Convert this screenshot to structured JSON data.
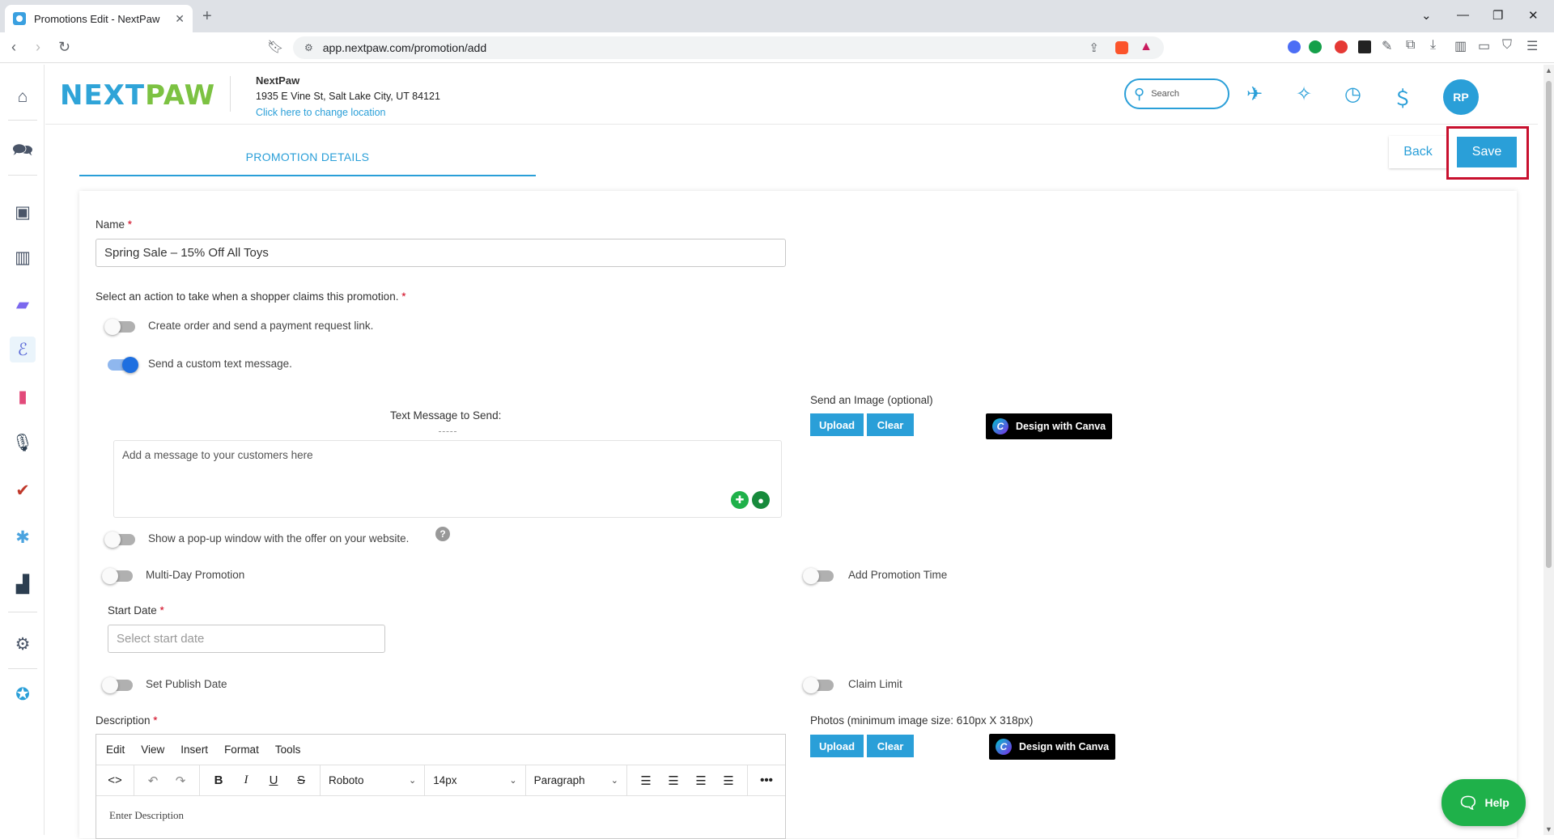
{
  "browser": {
    "tab_title": "Promotions Edit - NextPaw",
    "url": "app.nextpaw.com/promotion/add"
  },
  "header": {
    "logo_part1": "NEXT",
    "logo_part2": "PAW",
    "business_name": "NextPaw",
    "business_address": "1935 E Vine St, Salt Lake City, UT 84121",
    "change_location": "Click here to change location",
    "search_placeholder": "Search",
    "avatar_initials": "RP"
  },
  "page": {
    "tab_label": "PROMOTION DETAILS",
    "back_label": "Back",
    "save_label": "Save"
  },
  "form": {
    "name_label": "Name",
    "required_mark": "*",
    "name_value": "Spring Sale – 15% Off All Toys",
    "action_prompt": "Select an action to take when a shopper claims this promotion.",
    "action_create_order": "Create order and send a payment request link.",
    "action_custom_text": "Send a custom text message.",
    "text_message_label": "Text Message to Send:",
    "text_message_placeholder": "Add a message to your customers here",
    "send_image_label": "Send an Image (optional)",
    "upload_label": "Upload",
    "clear_label": "Clear",
    "canva_label": "Design with Canva",
    "popup_label": "Show a pop-up window with the offer on your website.",
    "multiday_label": "Multi-Day Promotion",
    "promo_time_label": "Add Promotion Time",
    "start_date_label": "Start Date",
    "start_date_placeholder": "Select start date",
    "publish_date_label": "Set Publish Date",
    "claim_limit_label": "Claim Limit",
    "description_label": "Description",
    "photos_label": "Photos (minimum image size: 610px X 318px)"
  },
  "editor": {
    "menu": [
      "Edit",
      "View",
      "Insert",
      "Format",
      "Tools"
    ],
    "font_family": "Roboto",
    "font_size": "14px",
    "block": "Paragraph",
    "placeholder": "Enter Description"
  },
  "help_label": "Help",
  "colors": {
    "primary": "#2a9fd8",
    "logo_green": "#7cc242",
    "highlight": "#c8102e",
    "help_green": "#1fb14a"
  }
}
